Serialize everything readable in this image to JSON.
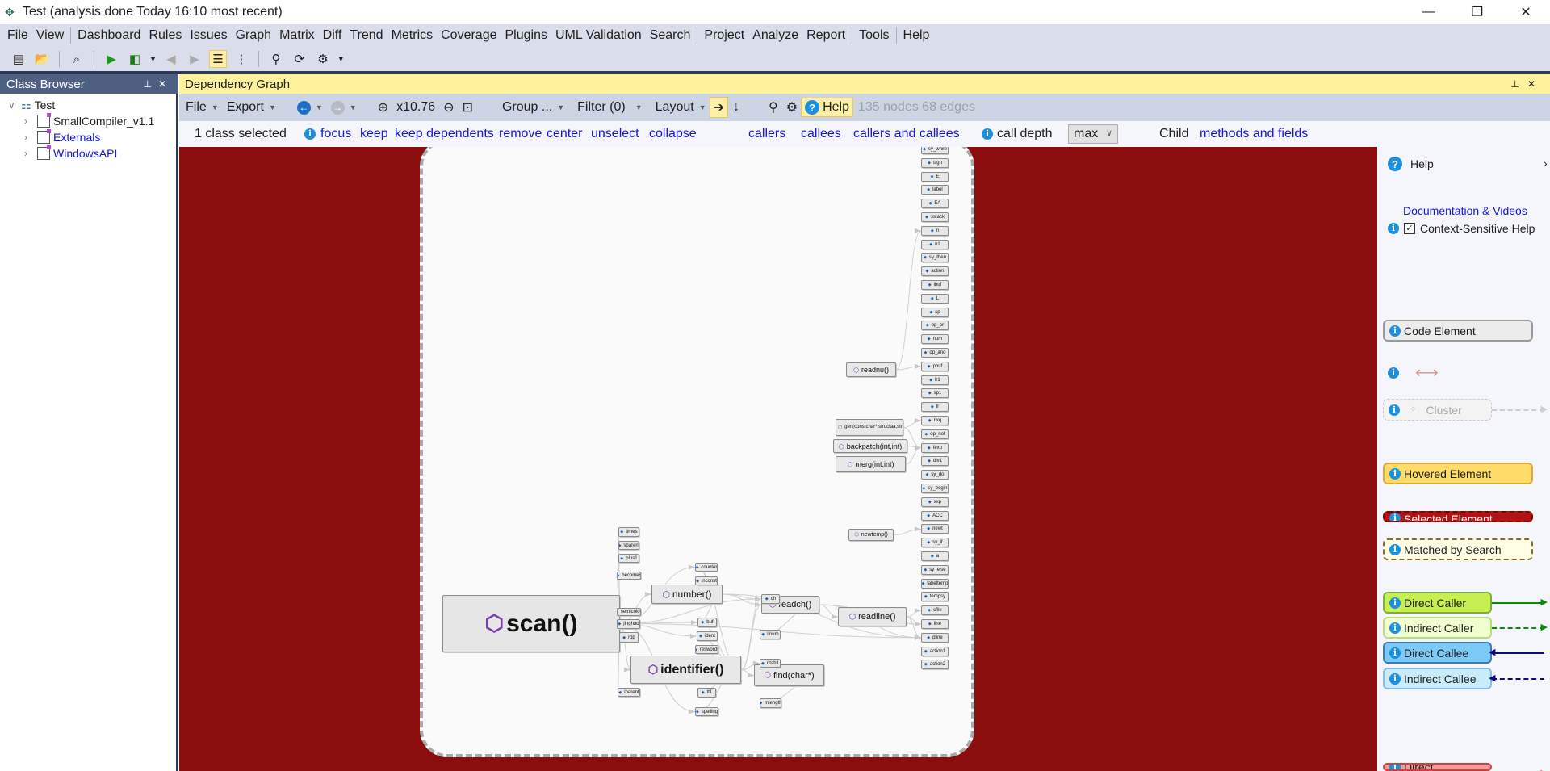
{
  "window": {
    "title": "Test  (analysis done Today 16:10 most recent)",
    "icon": "ndepend-logo-icon",
    "controls": [
      "minimize",
      "restore",
      "close"
    ]
  },
  "menu": [
    "File",
    "View",
    "|",
    "Dashboard",
    "Rules",
    "Issues",
    "Graph",
    "Matrix",
    "Diff",
    "Trend",
    "Metrics",
    "Coverage",
    "Plugins",
    "UML Validation",
    "Search",
    "|",
    "Project",
    "Analyze",
    "Report",
    "|",
    "Tools",
    "|",
    "Help"
  ],
  "toolbar": {
    "icons": [
      "new-project-icon",
      "open-project-icon",
      "dashboard-icon",
      "run-analysis-icon",
      "analyze-dropdown-icon",
      "back-icon",
      "forward-icon",
      "class-browser-icon",
      "queries-icon",
      "search-icon",
      "refresh-icon",
      "settings-icon"
    ]
  },
  "class_browser": {
    "title": "Class Browser",
    "items": [
      {
        "label": "Test",
        "expanded": true
      },
      {
        "label": "SmallCompiler_v1.1"
      },
      {
        "label": "Externals"
      },
      {
        "label": "WindowsAPI"
      }
    ]
  },
  "graph_panel": {
    "title": "Dependency Graph",
    "toolbar": {
      "file": "File",
      "export": "Export",
      "zoom": "x10.76",
      "group": "Group ...",
      "filter": "Filter (0)",
      "layout": "Layout",
      "help": "Help",
      "stats": "135 nodes 68 edges"
    },
    "actions": {
      "selected": "1 class selected",
      "focus": "focus",
      "keep": "keep",
      "keep_dependents": "keep dependents",
      "remove": "remove",
      "center": "center",
      "unselect": "unselect",
      "collapse": "collapse",
      "callers": "callers",
      "callees": "callees",
      "callers_and_callees": "callers and callees",
      "call_depth": "call depth",
      "call_depth_value": "max",
      "child": "Child",
      "methods_and_fields": "methods and fields"
    }
  },
  "graph": {
    "colors": {
      "background": "#8b0e0f",
      "node": "#e8e8e8",
      "method_icon": "#7a3fb0",
      "field_icon": "#1d5fb8"
    },
    "methods": [
      "scan()",
      "number()",
      "identifier()",
      "readch()",
      "readline()",
      "find(char*)",
      "readnu()",
      "gen(constchar*,structaa,structaa,int)",
      "backpatch(int,int)",
      "merg(int,int)",
      "newtemp()"
    ],
    "fields_column": [
      "sy_while",
      "sign",
      "E",
      "label",
      "EA",
      "sstack",
      "n",
      "n1",
      "sy_then",
      "action",
      "lbuf",
      "L",
      "sp",
      "op_or",
      "num",
      "op_and",
      "pbuf",
      "lr1",
      "sp1",
      "lr",
      "nxq",
      "op_not",
      "fexp",
      "div1",
      "sy_do",
      "sy_begin",
      "xxp",
      "ACC",
      "newt",
      "sy_if",
      "a",
      "sy_else",
      "labeltemp",
      "tempsy",
      "cfile",
      "line",
      "pline",
      "action1",
      "action2"
    ],
    "fields_other": [
      "times",
      "sparent",
      "plus1",
      "becomes",
      "counter",
      "inconst",
      "ch",
      "semicolon",
      "jinghao",
      "rop",
      "buf",
      "ident",
      "reswords",
      "linum",
      "ntab1",
      "tt1",
      "lparent",
      "mlength",
      "spelling"
    ],
    "edges": [
      [
        "scan()",
        "times"
      ],
      [
        "scan()",
        "sparent"
      ],
      [
        "scan()",
        "plus1"
      ],
      [
        "scan()",
        "becomes"
      ],
      [
        "scan()",
        "number()"
      ],
      [
        "scan()",
        "semicolon"
      ],
      [
        "scan()",
        "jinghao"
      ],
      [
        "scan()",
        "rop"
      ],
      [
        "scan()",
        "identifier()"
      ],
      [
        "scan()",
        "lparent"
      ],
      [
        "scan()",
        "ch"
      ],
      [
        "scan()",
        "buf"
      ],
      [
        "scan()",
        "ident"
      ],
      [
        "scan()",
        "counter"
      ],
      [
        "scan()",
        "pline"
      ],
      [
        "scan()",
        "spelling"
      ],
      [
        "number()",
        "counter"
      ],
      [
        "number()",
        "inconst"
      ],
      [
        "number()",
        "readch()"
      ],
      [
        "number()",
        "ch"
      ],
      [
        "number()",
        "buf"
      ],
      [
        "number()",
        "pline"
      ],
      [
        "identifier()",
        "readch()"
      ],
      [
        "identifier()",
        "find(char*)"
      ],
      [
        "identifier()",
        "buf"
      ],
      [
        "identifier()",
        "ident"
      ],
      [
        "identifier()",
        "reswords"
      ],
      [
        "identifier()",
        "ntab1"
      ],
      [
        "identifier()",
        "tt1"
      ],
      [
        "identifier()",
        "spelling"
      ],
      [
        "identifier()",
        "ch"
      ],
      [
        "identifier()",
        "counter"
      ],
      [
        "readch()",
        "ch"
      ],
      [
        "readch()",
        "readline()"
      ],
      [
        "readch()",
        "linum"
      ],
      [
        "readch()",
        "pline"
      ],
      [
        "readch()",
        "line"
      ],
      [
        "readline()",
        "cfile"
      ],
      [
        "readline()",
        "line"
      ],
      [
        "readline()",
        "pline"
      ],
      [
        "find(char*)",
        "ntab1"
      ],
      [
        "find(char*)",
        "mlength"
      ],
      [
        "readnu()",
        "pbuf"
      ],
      [
        "readnu()",
        "n"
      ],
      [
        "gen(constchar*,structaa,structaa,int)",
        "nxq"
      ],
      [
        "gen(constchar*,structaa,structaa,int)",
        "fexp"
      ],
      [
        "backpatch(int,int)",
        "fexp"
      ],
      [
        "merg(int,int)",
        "fexp"
      ],
      [
        "newtemp()",
        "newt"
      ]
    ]
  },
  "help_panel": {
    "title": "Help",
    "docs_link": "Documentation & Videos",
    "context_help": "Context-Sensitive Help",
    "context_help_checked": true,
    "legend": [
      {
        "label": "Code Element",
        "color": "#ececec",
        "border": "#9a9a9a"
      },
      {
        "label": "Cluster",
        "color": "#f3f3f3",
        "border": "#c8c8c8"
      },
      {
        "label": "Hovered Element",
        "color": "#ffdc6a",
        "border": "#d9a93a"
      },
      {
        "label": "Selected Element",
        "color": "#b01414",
        "border": "#6b0a0a"
      },
      {
        "label": "Matched by Search",
        "color": "#ffffe6",
        "border": "#8a6a2a"
      },
      {
        "label": "Direct Caller",
        "color": "#c6ef52",
        "border": "#7ab03a",
        "arrow": "#0a8a0a"
      },
      {
        "label": "Indirect Caller",
        "color": "#efffd0",
        "border": "#b8dd7a",
        "arrow": "#0a8a0a"
      },
      {
        "label": "Direct Callee",
        "color": "#7ccaf5",
        "border": "#3b79b8",
        "arrow": "#0a0a80"
      },
      {
        "label": "Indirect Callee",
        "color": "#c9ebfc",
        "border": "#80bde6",
        "arrow": "#0a0a80"
      },
      {
        "label": "Direct",
        "color": "#f39a9a",
        "border": "#d04040",
        "arrow": "#d02020"
      }
    ],
    "dependency_arrow_color": "#d49a9a"
  }
}
